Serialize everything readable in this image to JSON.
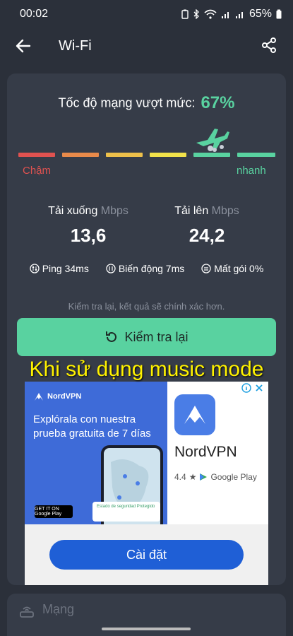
{
  "status_bar": {
    "time": "00:02",
    "battery_percent": "65%"
  },
  "header": {
    "title": "Wi-Fi"
  },
  "result": {
    "exceed_label": "Tốc độ mạng vượt mức:",
    "exceed_value": "67%",
    "scale_low": "Chậm",
    "scale_high": "nhanh",
    "scale_colors": [
      "#e05250",
      "#e98a4a",
      "#eec04a",
      "#f2e24a",
      "#59d2a0",
      "#59d2a0"
    ],
    "download_label": "Tải xuống",
    "download_unit": "Mbps",
    "download_value": "13,6",
    "upload_label": "Tải lên",
    "upload_unit": "Mbps",
    "upload_value": "24,2",
    "ping": "Ping 34ms",
    "jitter": "Biến động 7ms",
    "loss": "Mất gói 0%",
    "hint": "Kiểm tra lại, kết quả sẽ chính xác hơn.",
    "retest_label": "Kiểm tra lại"
  },
  "caption": "Khi sử dụng music mode",
  "ad": {
    "brand": "NordVPN",
    "headline": "Explórala con nuestra prueba gratuita de 7 días",
    "phone_card_text": "Estado de seguridad Protegido",
    "badge_text": "GET IT ON Google Play",
    "app_name": "NordVPN",
    "rating": "4.4",
    "store": "Google Play",
    "install_label": "Cài đặt"
  },
  "bottom": {
    "network_label": "Mạng"
  }
}
